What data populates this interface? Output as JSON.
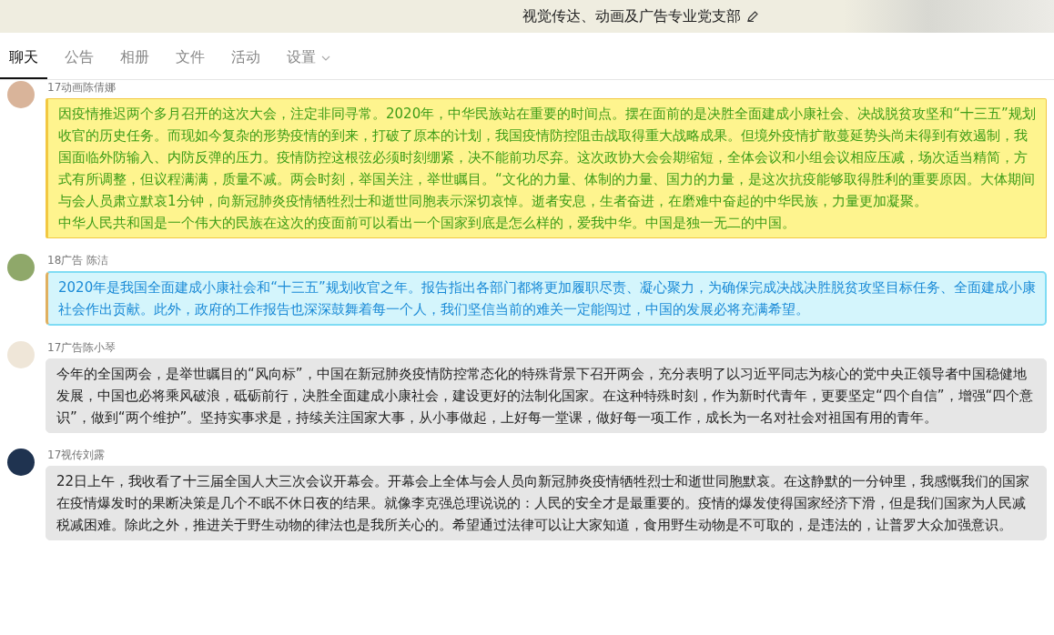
{
  "group": {
    "title": "视觉传达、动画及广告专业党支部"
  },
  "tabs": [
    {
      "label": "聊天",
      "selected": true
    },
    {
      "label": "公告",
      "selected": false
    },
    {
      "label": "相册",
      "selected": false
    },
    {
      "label": "文件",
      "selected": false
    },
    {
      "label": "活动",
      "selected": false
    },
    {
      "label": "设置",
      "selected": false,
      "dropdown": true
    }
  ],
  "messages": [
    {
      "sender": "17动画陈倩娜",
      "kind": "yellow",
      "paragraphs": [
        "因疫情推迟两个多月召开的这次大会，注定非同寻常。2020年，中华民族站在重要的时间点。摆在面前的是决胜全面建成小康社会、决战脱贫攻坚和“十三五”规划收官的历史任务。而现如今复杂的形势疫情的到来，打破了原本的计划，我国疫情防控阻击战取得重大战略成果。但境外疫情扩散蔓延势头尚未得到有效遏制，我国面临外防输入、内防反弹的压力。疫情防控这根弦必须时刻绷紧，决不能前功尽弃。这次政协大会会期缩短，全体会议和小组会议相应压减，场次适当精简，方式有所调整，但议程满满，质量不减。两会时刻，举国关注，举世瞩目。“文化的力量、体制的力量、国力的力量，是这次抗疫能够取得胜利的重要原因。大体期间与会人员肃立默哀1分钟，向新冠肺炎疫情牺牲烈士和逝世同胞表示深切哀悼。逝者安息，生者奋进，在磨难中奋起的中华民族，力量更加凝聚。",
        "中华人民共和国是一个伟大的民族在这次的疫面前可以看出一个国家到底是怎么样的，爱我中华。中国是独一无二的中国。"
      ]
    },
    {
      "sender": "18广告 陈洁",
      "kind": "cyan",
      "paragraphs": [
        "2020年是我国全面建成小康社会和“十三五”规划收官之年。报告指出各部门都将更加履职尽责、凝心聚力，为确保完成决战决胜脱贫攻坚目标任务、全面建成小康社会作出贡献。此外，政府的工作报告也深深鼓舞着每一个人，我们坚信当前的难关一定能闯过，中国的发展必将充满希望。"
      ]
    },
    {
      "sender": "17广告陈小琴",
      "kind": "plain",
      "paragraphs": [
        "今年的全国两会，是举世瞩目的“风向标”，中国在新冠肺炎疫情防控常态化的特殊背景下召开两会，充分表明了以习近平同志为核心的党中央正领导者中国稳健地发展，中国也必将乘风破浪，砥砺前行，决胜全面建成小康社会，建设更好的法制化国家。在这种特殊时刻，作为新时代青年，更要坚定“四个自信”，增强“四个意识”，做到“两个维护”。坚持实事求是，持续关注国家大事，从小事做起，上好每一堂课，做好每一项工作，成长为一名对社会对祖国有用的青年。"
      ]
    },
    {
      "sender": "17视传刘露",
      "kind": "plain",
      "paragraphs": [
        "22日上午，我收看了十三届全国人大三次会议开幕会。开幕会上全体与会人员向新冠肺炎疫情牺牲烈士和逝世同胞默哀。在这静默的一分钟里，我感慨我们的国家在疫情爆发时的果断决策是几个不眠不休日夜的结果。就像李克强总理说说的：人民的安全才是最重要的。疫情的爆发使得国家经济下滑，但是我们国家为人民减税减困难。除此之外，推进关于野生动物的律法也是我所关心的。希望通过法律可以让大家知道，食用野生动物是不可取的，是违法的，让普罗大众加强意识。"
      ]
    }
  ]
}
